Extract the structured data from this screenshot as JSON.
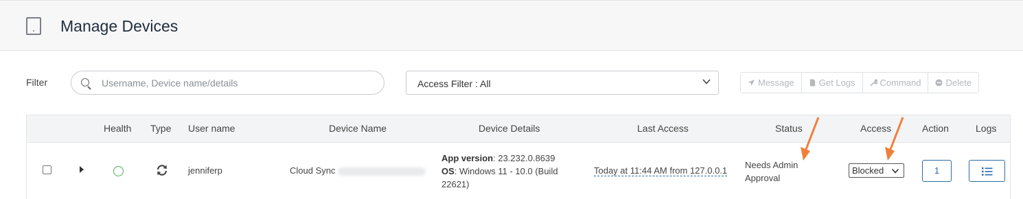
{
  "header": {
    "title": "Manage Devices",
    "icon": "tablet-icon"
  },
  "filter": {
    "label": "Filter",
    "search_placeholder": "Username, Device name/details",
    "access_filter_label": "Access Filter : All"
  },
  "toolbar": {
    "buttons": [
      {
        "label": "Message",
        "icon": "send-icon"
      },
      {
        "label": "Get Logs",
        "icon": "file-icon"
      },
      {
        "label": "Command",
        "icon": "wrench-icon"
      },
      {
        "label": "Delete",
        "icon": "minus-circle-icon"
      }
    ]
  },
  "table": {
    "columns": [
      "Health",
      "Type",
      "User name",
      "Device Name",
      "Device Details",
      "Last Access",
      "Status",
      "Access",
      "Action",
      "Logs"
    ],
    "rows": [
      {
        "health": "healthy",
        "type_icon": "sync-icon",
        "user_name": "jenniferp",
        "device_name": "Cloud Sync",
        "app_version_label": "App version",
        "app_version": ": 23.232.0.8639",
        "os_label": "OS",
        "os": ": Windows 11 - 10.0 (Build 22621)",
        "last_access": "Today at 11:44 AM from 127.0.0.1",
        "status": "Needs Admin Approval",
        "access": "Blocked",
        "action": "1"
      }
    ]
  },
  "colors": {
    "accent": "#2c6aa6",
    "health_ok": "#4caf50",
    "annotation_arrow": "#f07f3c"
  }
}
